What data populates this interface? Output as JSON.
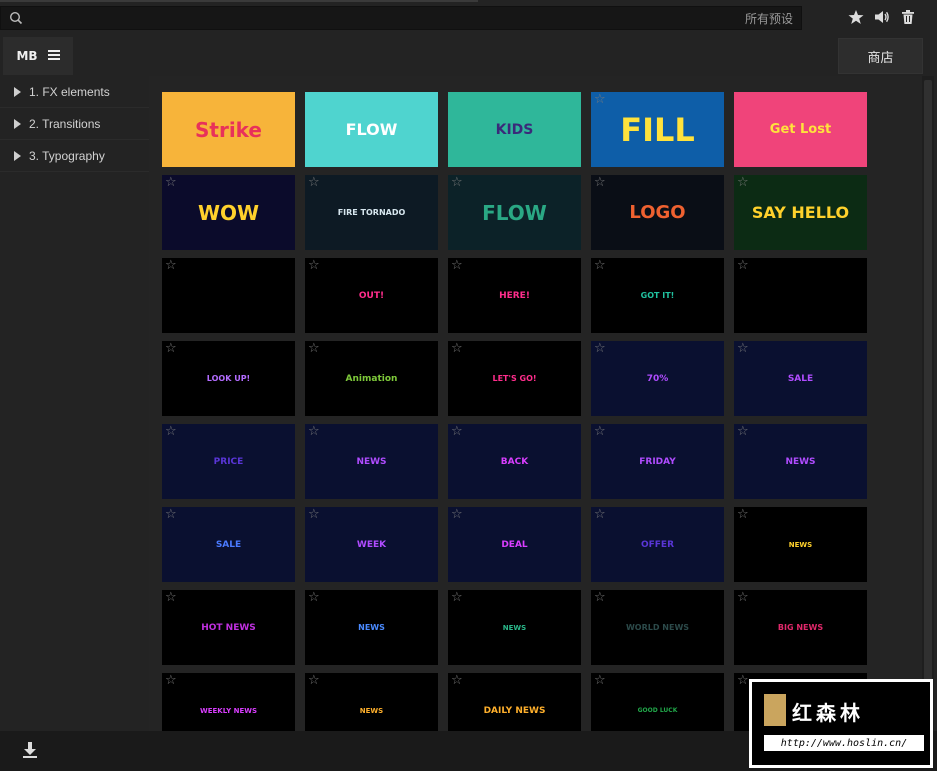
{
  "search": {
    "value": "",
    "scope_label": "所有预设"
  },
  "toolbar": {
    "star_icon": "star-icon",
    "audio_icon": "speaker-icon",
    "trash_icon": "trash-icon"
  },
  "tabs": {
    "mb_label": "MB"
  },
  "store": {
    "label": "商店"
  },
  "sidebar": {
    "items": [
      {
        "label": "1. FX elements"
      },
      {
        "label": "2. Transitions"
      },
      {
        "label": "3. Typography"
      }
    ]
  },
  "presets": [
    {
      "label": "Strike",
      "bg": "#f7b43a",
      "fg": "#e8315a",
      "size": 20
    },
    {
      "label": "FLOW",
      "bg": "#4fd4cf",
      "fg": "#ffffff",
      "size": 16
    },
    {
      "label": "KIDS",
      "bg": "#2fb79a",
      "fg": "#3a2a7a",
      "size": 14
    },
    {
      "label": "FILL",
      "bg": "#0e5ea8",
      "fg": "#ffe23c",
      "size": 32
    },
    {
      "label": "Get Lost",
      "bg": "#f0447a",
      "fg": "#ffe23c",
      "size": 13
    },
    {
      "label": "WOW",
      "bg": "#0b0b2b",
      "fg": "#ffd12c",
      "size": 20
    },
    {
      "label": "FIRE TORNADO",
      "bg": "#0d1a24",
      "fg": "#d7e7ef",
      "size": 8
    },
    {
      "label": "FLOW",
      "bg": "#0c2228",
      "fg": "#2aa884",
      "size": 20
    },
    {
      "label": "LOGO",
      "bg": "#0a0e16",
      "fg": "#ef6130",
      "size": 18
    },
    {
      "label": "SAY HELLO",
      "bg": "#0c2b14",
      "fg": "#ffd12c",
      "size": 16
    },
    {
      "label": "",
      "bg": "#000000",
      "fg": "#e0287a",
      "size": 8
    },
    {
      "label": "OUT!",
      "bg": "#000000",
      "fg": "#ff2d8c",
      "size": 9
    },
    {
      "label": "HERE!",
      "bg": "#000000",
      "fg": "#ff2d8c",
      "size": 9
    },
    {
      "label": "GOT IT!",
      "bg": "#000000",
      "fg": "#21c2a0",
      "size": 8
    },
    {
      "label": "",
      "bg": "#000000",
      "fg": "#5ab0ff",
      "size": 8
    },
    {
      "label": "LOOK UP!",
      "bg": "#000000",
      "fg": "#b36cff",
      "size": 8
    },
    {
      "label": "Animation",
      "bg": "#000000",
      "fg": "#7ec93a",
      "size": 9
    },
    {
      "label": "LET'S GO!",
      "bg": "#000000",
      "fg": "#ff2d8c",
      "size": 8
    },
    {
      "label": "70%",
      "bg": "#0a1030",
      "fg": "#b04cff",
      "size": 9
    },
    {
      "label": "SALE",
      "bg": "#0a1030",
      "fg": "#b04cff",
      "size": 9
    },
    {
      "label": "PRICE",
      "bg": "#0a1030",
      "fg": "#5a36d8",
      "size": 9
    },
    {
      "label": "NEWS",
      "bg": "#0a1030",
      "fg": "#b04cff",
      "size": 9
    },
    {
      "label": "BACK",
      "bg": "#0a1030",
      "fg": "#d93eff",
      "size": 9
    },
    {
      "label": "FRIDAY",
      "bg": "#0a1030",
      "fg": "#b04cff",
      "size": 9
    },
    {
      "label": "NEWS",
      "bg": "#0a1030",
      "fg": "#b04cff",
      "size": 9
    },
    {
      "label": "SALE",
      "bg": "#0a1030",
      "fg": "#4a7aff",
      "size": 9
    },
    {
      "label": "WEEK",
      "bg": "#0a1030",
      "fg": "#b04cff",
      "size": 9
    },
    {
      "label": "DEAL",
      "bg": "#0a1030",
      "fg": "#d93eff",
      "size": 9
    },
    {
      "label": "OFFER",
      "bg": "#0a1030",
      "fg": "#5a36d8",
      "size": 9
    },
    {
      "label": "NEWS",
      "bg": "#000000",
      "fg": "#ffd12c",
      "size": 7
    },
    {
      "label": "HOT NEWS",
      "bg": "#000000",
      "fg": "#c030e0",
      "size": 9
    },
    {
      "label": "NEWS",
      "bg": "#000000",
      "fg": "#4a8aff",
      "size": 8
    },
    {
      "label": "NEWS",
      "bg": "#000000",
      "fg": "#2ab88a",
      "size": 7
    },
    {
      "label": "WORLD NEWS",
      "bg": "#000000",
      "fg": "#2c4a4a",
      "size": 8
    },
    {
      "label": "BIG NEWS",
      "bg": "#000000",
      "fg": "#e0286a",
      "size": 8
    },
    {
      "label": "WEEKLY NEWS",
      "bg": "#000000",
      "fg": "#d93eff",
      "size": 7
    },
    {
      "label": "NEWS",
      "bg": "#000000",
      "fg": "#ffb02c",
      "size": 7
    },
    {
      "label": "DAILY NEWS",
      "bg": "#000000",
      "fg": "#ffb02c",
      "size": 9
    },
    {
      "label": "GOOD LUCK",
      "bg": "#000000",
      "fg": "#21a84a",
      "size": 6
    },
    {
      "label": "",
      "bg": "#000000",
      "fg": "#ffffff",
      "size": 8
    }
  ],
  "footer": {
    "download_icon": "download-icon",
    "view_icon": "grid-view-icon"
  },
  "watermark": {
    "title": "红森林",
    "url": "http://www.hoslin.cn/"
  }
}
